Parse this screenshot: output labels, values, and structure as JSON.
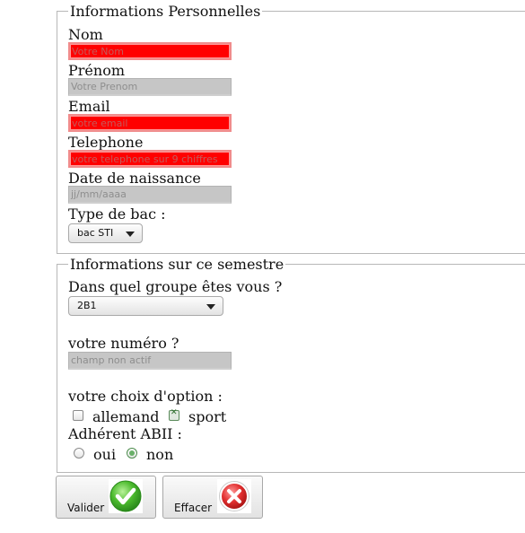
{
  "personal": {
    "legend": "Informations Personnelles",
    "nom": {
      "label": "Nom",
      "placeholder": "Votre Nom"
    },
    "prenom": {
      "label": "Prénom",
      "placeholder": "Votre Prenom"
    },
    "email": {
      "label": "Email",
      "placeholder": "votre email"
    },
    "telephone": {
      "label": "Telephone",
      "placeholder": "votre telephone sur 9 chiffres"
    },
    "naissance": {
      "label": "Date de naissance",
      "placeholder": "jj/mm/aaaa"
    },
    "bac": {
      "label": "Type de bac :",
      "selected": "bac STI"
    }
  },
  "semester": {
    "legend": "Informations sur ce semestre",
    "groupe": {
      "label": "Dans quel groupe êtes vous ?",
      "selected": "2B1"
    },
    "numero": {
      "label": "votre numéro ?",
      "placeholder": "champ non actif"
    },
    "option": {
      "label": "votre choix d'option :",
      "allemand": "allemand",
      "sport": "sport",
      "allemand_checked": false,
      "sport_checked": true
    },
    "abii": {
      "label": "Adhérent ABII :",
      "oui": "oui",
      "non": "non",
      "selected": "non"
    }
  },
  "buttons": {
    "valider": "Valider",
    "effacer": "Effacer"
  },
  "icons": {
    "valider": "green-checkmark-icon",
    "effacer": "red-cross-icon"
  },
  "colors": {
    "error_bg": "#ff0000",
    "disabled_bg": "#c6c6c6",
    "ok_green": "#3fae2a",
    "cancel_red": "#d62b2b"
  }
}
